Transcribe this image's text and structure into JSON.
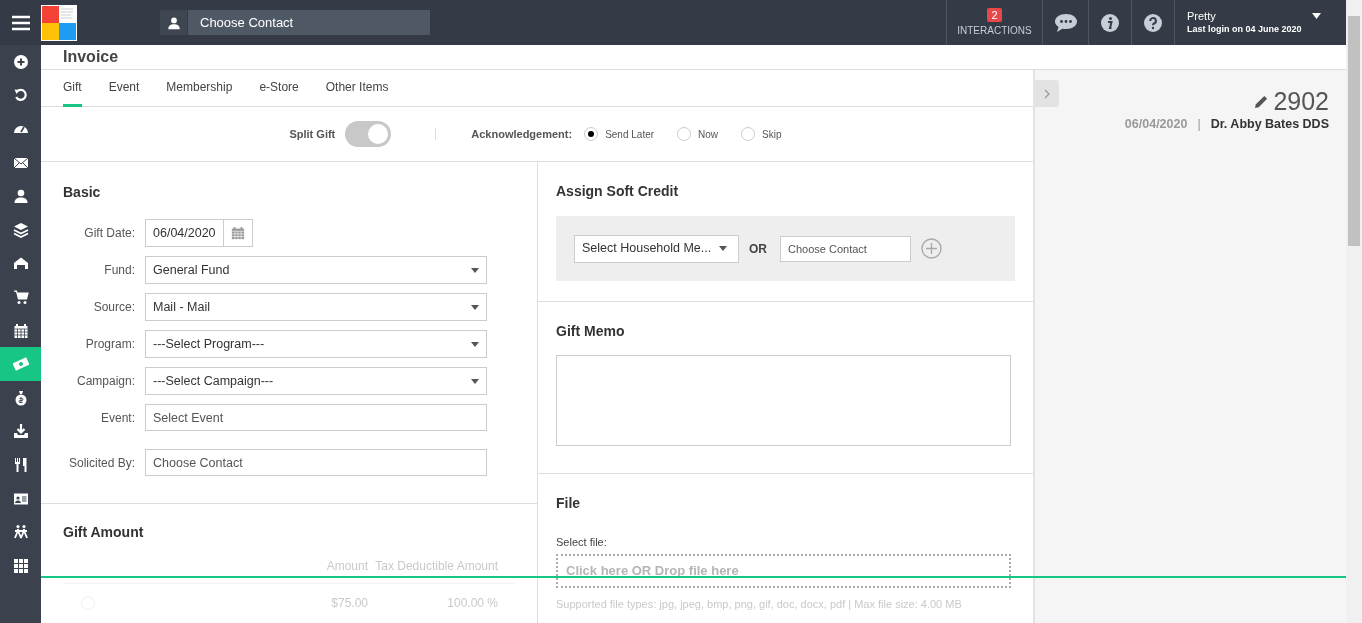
{
  "top_bar": {
    "contact_search": {
      "placeholder": "Choose Contact"
    },
    "interactions": {
      "count": "2",
      "label": "INTERACTIONS"
    },
    "user": {
      "name": "Pretty",
      "last_login": "Last login on 04 June 2020"
    }
  },
  "sidebar": {
    "items": [
      {
        "kind": "plus",
        "selected": false
      },
      {
        "kind": "undo",
        "selected": false
      },
      {
        "kind": "gauge",
        "selected": false
      },
      {
        "kind": "mail",
        "selected": false
      },
      {
        "kind": "person",
        "selected": false
      },
      {
        "kind": "layers",
        "selected": false
      },
      {
        "kind": "house",
        "selected": false
      },
      {
        "kind": "cart",
        "selected": false
      },
      {
        "kind": "calendar",
        "selected": false
      },
      {
        "kind": "money",
        "selected": true
      },
      {
        "kind": "bag",
        "selected": false
      },
      {
        "kind": "download",
        "selected": false
      },
      {
        "kind": "utensils",
        "selected": false
      },
      {
        "kind": "card",
        "selected": false
      },
      {
        "kind": "people",
        "selected": false
      },
      {
        "kind": "grid",
        "selected": false
      }
    ]
  },
  "page_title": "Invoice",
  "tabs": [
    {
      "label": "Gift",
      "selected": true
    },
    {
      "label": "Event",
      "selected": false
    },
    {
      "label": "Membership",
      "selected": false
    },
    {
      "label": "e-Store",
      "selected": false
    },
    {
      "label": "Other Items",
      "selected": false
    }
  ],
  "split_gift": {
    "label": "Split Gift",
    "on": true
  },
  "acknowledgement": {
    "label": "Acknowledgement:",
    "options": [
      {
        "label": "Send Later",
        "selected": true
      },
      {
        "label": "Now",
        "selected": false
      },
      {
        "label": "Skip",
        "selected": false
      }
    ]
  },
  "basic": {
    "title": "Basic",
    "fields": [
      {
        "label": "Gift Date:",
        "kind": "date",
        "value": "06/04/2020"
      },
      {
        "label": "Fund:",
        "kind": "select",
        "value": "General Fund"
      },
      {
        "label": "Source:",
        "kind": "select",
        "value": "Mail - Mail"
      },
      {
        "label": "Program:",
        "kind": "select",
        "value": "---Select Program---"
      },
      {
        "label": "Campaign:",
        "kind": "select",
        "value": "---Select Campaign---"
      },
      {
        "label": "Event:",
        "kind": "text",
        "placeholder": "Select Event"
      },
      {
        "label": "Solicited By:",
        "kind": "text",
        "placeholder": "Choose Contact"
      }
    ]
  },
  "gift_amount": {
    "title": "Gift Amount",
    "columns": [
      "Amount",
      "Tax Deductible Amount"
    ],
    "rows": [
      {
        "selected": false,
        "cells": [
          "$75.00",
          "100.00 %"
        ]
      }
    ]
  },
  "soft_credit": {
    "title": "Assign Soft Credit",
    "household_select": "Select Household Me...",
    "or": "OR",
    "contact": {
      "placeholder": "Choose Contact"
    }
  },
  "gift_memo": {
    "title": "Gift Memo"
  },
  "file": {
    "title": "File",
    "label": "Select file:",
    "dropzone": "Click here OR Drop file here",
    "hint": "Supported file types: jpg, jpeg, bmp, png, gif, doc, docx, pdf | Max file size: 4.00 MB"
  },
  "summary": {
    "number": "2902",
    "date": "06/04/2020",
    "separator": "|",
    "contact": "Dr. Abby Bates DDS"
  }
}
